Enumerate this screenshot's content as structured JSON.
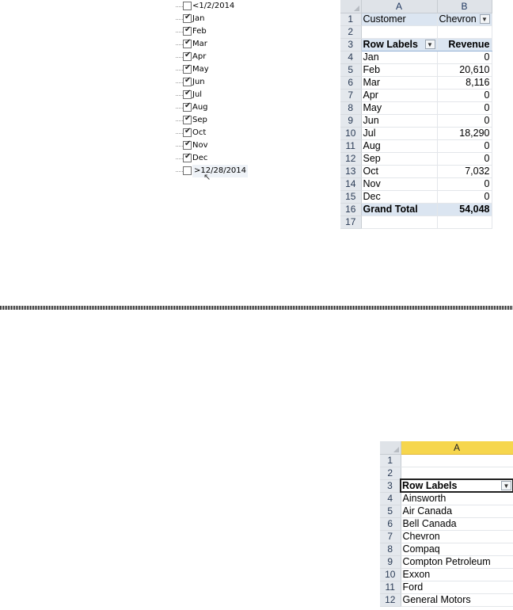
{
  "date_filter": {
    "items": [
      {
        "label": "<1/2/2014",
        "checked": false
      },
      {
        "label": "Jan",
        "checked": true
      },
      {
        "label": "Feb",
        "checked": true
      },
      {
        "label": "Mar",
        "checked": true
      },
      {
        "label": "Apr",
        "checked": true
      },
      {
        "label": "May",
        "checked": true
      },
      {
        "label": "Jun",
        "checked": true
      },
      {
        "label": "Jul",
        "checked": true
      },
      {
        "label": "Aug",
        "checked": true
      },
      {
        "label": "Sep",
        "checked": true
      },
      {
        "label": "Oct",
        "checked": true
      },
      {
        "label": "Nov",
        "checked": true
      },
      {
        "label": "Dec",
        "checked": true
      },
      {
        "label": ">12/28/2014",
        "checked": false
      }
    ]
  },
  "pivot1": {
    "col_headers": [
      "A",
      "B"
    ],
    "filter_row": {
      "row": "1",
      "label": "Customer",
      "value": "Chevron"
    },
    "blank_row": "2",
    "header_row": {
      "row": "3",
      "row_labels": "Row Labels",
      "value_header": "Revenue"
    },
    "rows": [
      {
        "row": "4",
        "label": "Jan",
        "value": "0"
      },
      {
        "row": "5",
        "label": "Feb",
        "value": "20,610"
      },
      {
        "row": "6",
        "label": "Mar",
        "value": "8,116"
      },
      {
        "row": "7",
        "label": "Apr",
        "value": "0"
      },
      {
        "row": "8",
        "label": "May",
        "value": "0"
      },
      {
        "row": "9",
        "label": "Jun",
        "value": "0"
      },
      {
        "row": "10",
        "label": "Jul",
        "value": "18,290"
      },
      {
        "row": "11",
        "label": "Aug",
        "value": "0"
      },
      {
        "row": "12",
        "label": "Sep",
        "value": "0"
      },
      {
        "row": "13",
        "label": "Oct",
        "value": "7,032"
      },
      {
        "row": "14",
        "label": "Nov",
        "value": "0"
      },
      {
        "row": "15",
        "label": "Dec",
        "value": "0"
      }
    ],
    "total_row": {
      "row": "16",
      "label": "Grand Total",
      "value": "54,048"
    },
    "last_row": "17"
  },
  "pivot2": {
    "col_header": "A",
    "blank_rows": [
      "1",
      "2"
    ],
    "header_row": {
      "row": "3",
      "label": "Row Labels"
    },
    "rows": [
      {
        "row": "4",
        "label": "Ainsworth"
      },
      {
        "row": "5",
        "label": "Air Canada"
      },
      {
        "row": "6",
        "label": "Bell Canada"
      },
      {
        "row": "7",
        "label": "Chevron"
      },
      {
        "row": "8",
        "label": "Compaq"
      },
      {
        "row": "9",
        "label": "Compton Petroleum"
      },
      {
        "row": "10",
        "label": "Exxon"
      },
      {
        "row": "11",
        "label": "Ford"
      },
      {
        "row": "12",
        "label": "General Motors"
      }
    ]
  },
  "colors": {
    "pivot_header_fill": "#dbe5f1",
    "selected_column_header": "#f6d64d"
  }
}
